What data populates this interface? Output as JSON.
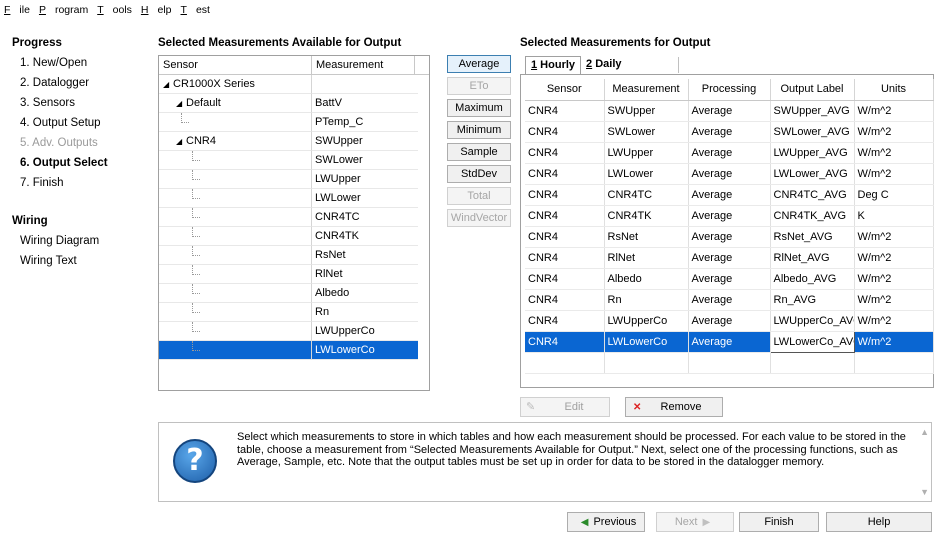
{
  "menu": [
    "File",
    "Program",
    "Tools",
    "Help",
    "Test"
  ],
  "nav": {
    "progress_title": "Progress",
    "steps": [
      {
        "label": "1. New/Open",
        "state": "normal"
      },
      {
        "label": "2. Datalogger",
        "state": "normal"
      },
      {
        "label": "3. Sensors",
        "state": "normal"
      },
      {
        "label": "4. Output Setup",
        "state": "normal"
      },
      {
        "label": "5. Adv. Outputs",
        "state": "disabled"
      },
      {
        "label": "6. Output Select",
        "state": "active"
      },
      {
        "label": "7. Finish",
        "state": "normal"
      }
    ],
    "wiring_title": "Wiring",
    "wiring_items": [
      "Wiring Diagram",
      "Wiring Text"
    ]
  },
  "available": {
    "title": "Selected Measurements Available for Output",
    "col_sensor": "Sensor",
    "col_measurement": "Measurement",
    "rows": [
      {
        "sensor": "CR1000X Series",
        "measurement": "",
        "level": 0,
        "expander": true
      },
      {
        "sensor": "Default",
        "measurement": "BattV",
        "level": 1,
        "expander": true
      },
      {
        "sensor": "",
        "measurement": "PTemp_C",
        "level": 2
      },
      {
        "sensor": "CNR4",
        "measurement": "SWUpper",
        "level": 1,
        "expander": true
      },
      {
        "sensor": "",
        "measurement": "SWLower",
        "level": 2
      },
      {
        "sensor": "",
        "measurement": "LWUpper",
        "level": 2
      },
      {
        "sensor": "",
        "measurement": "LWLower",
        "level": 2
      },
      {
        "sensor": "",
        "measurement": "CNR4TC",
        "level": 2
      },
      {
        "sensor": "",
        "measurement": "CNR4TK",
        "level": 2
      },
      {
        "sensor": "",
        "measurement": "RsNet",
        "level": 2
      },
      {
        "sensor": "",
        "measurement": "RlNet",
        "level": 2
      },
      {
        "sensor": "",
        "measurement": "Albedo",
        "level": 2
      },
      {
        "sensor": "",
        "measurement": "Rn",
        "level": 2
      },
      {
        "sensor": "",
        "measurement": "LWUpperCo",
        "level": 2
      },
      {
        "sensor": "",
        "measurement": "LWLowerCo",
        "level": 2,
        "selected": true
      }
    ]
  },
  "functions": [
    {
      "label": "Average",
      "enabled": true,
      "focused": true
    },
    {
      "label": "ETo",
      "enabled": false
    },
    {
      "label": "Maximum",
      "enabled": true
    },
    {
      "label": "Minimum",
      "enabled": true
    },
    {
      "label": "Sample",
      "enabled": true
    },
    {
      "label": "StdDev",
      "enabled": true
    },
    {
      "label": "Total",
      "enabled": false
    },
    {
      "label": "WindVector",
      "enabled": false
    }
  ],
  "output": {
    "title": "Selected Measurements for Output",
    "tabs": [
      {
        "num": "1",
        "rest": " Hourly",
        "active": true
      },
      {
        "num": "2",
        "rest": " Daily",
        "active": false
      }
    ],
    "columns": [
      "Sensor",
      "Measurement",
      "Processing",
      "Output Label",
      "Units"
    ],
    "rows": [
      [
        "CNR4",
        "SWUpper",
        "Average",
        "SWUpper_AVG",
        "W/m^2"
      ],
      [
        "CNR4",
        "SWLower",
        "Average",
        "SWLower_AVG",
        "W/m^2"
      ],
      [
        "CNR4",
        "LWUpper",
        "Average",
        "LWUpper_AVG",
        "W/m^2"
      ],
      [
        "CNR4",
        "LWLower",
        "Average",
        "LWLower_AVG",
        "W/m^2"
      ],
      [
        "CNR4",
        "CNR4TC",
        "Average",
        "CNR4TC_AVG",
        "Deg C"
      ],
      [
        "CNR4",
        "CNR4TK",
        "Average",
        "CNR4TK_AVG",
        "K"
      ],
      [
        "CNR4",
        "RsNet",
        "Average",
        "RsNet_AVG",
        "W/m^2"
      ],
      [
        "CNR4",
        "RlNet",
        "Average",
        "RlNet_AVG",
        "W/m^2"
      ],
      [
        "CNR4",
        "Albedo",
        "Average",
        "Albedo_AVG",
        "W/m^2"
      ],
      [
        "CNR4",
        "Rn",
        "Average",
        "Rn_AVG",
        "W/m^2"
      ],
      [
        "CNR4",
        "LWUpperCo",
        "Average",
        "LWUpperCo_AVG",
        "W/m^2"
      ],
      [
        "CNR4",
        "LWLowerCo",
        "Average",
        "LWLowerCo_AVG",
        "W/m^2"
      ]
    ],
    "selected_row": 11,
    "edit_label": "Edit",
    "remove_label": "Remove"
  },
  "help_text": "Select which measurements to store in which tables and how each measurement should be processed. For each value to be stored in the table, choose a measurement from “Selected Measurements Available for Output.”  Next, select one of the processing functions, such as Average, Sample, etc. Note that the output tables must be set up in order for data to be stored in the datalogger memory.",
  "bottom": {
    "previous": "Previous",
    "next": "Next",
    "finish": "Finish",
    "help": "Help"
  }
}
